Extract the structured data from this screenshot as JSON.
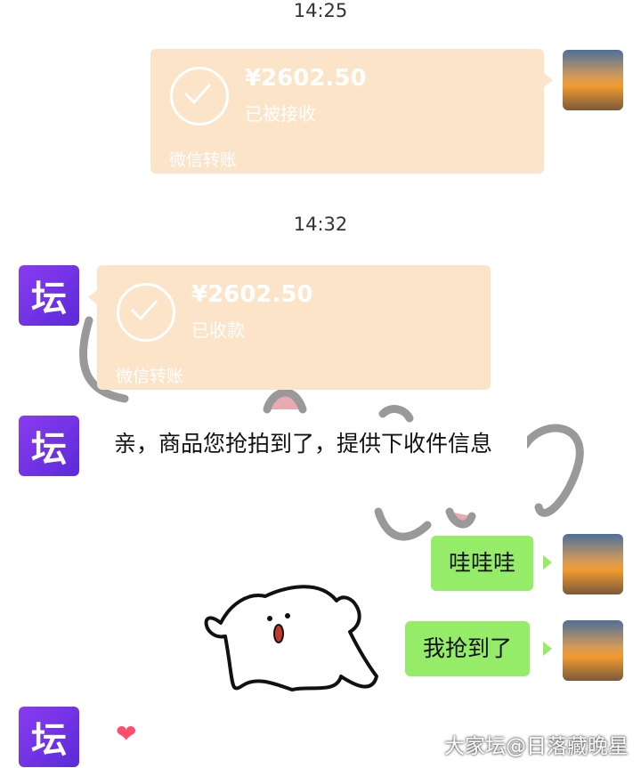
{
  "messages": {
    "time1": "14:25",
    "transfer1": {
      "amount": "¥2602.50",
      "status": "已被接收",
      "brand": "微信转账"
    },
    "time2": "14:32",
    "transfer2": {
      "amount": "¥2602.50",
      "status": "已收款",
      "brand": "微信转账"
    },
    "forum_avatar_text": "坛",
    "text_msg": "亲，商品您抢拍到了，提供下收件信息",
    "reply1": "哇哇哇",
    "reply2": "我抢到了",
    "heart": "❤"
  },
  "watermark": "大家坛@日落藏晚星",
  "colors": {
    "transfer_bg": "#fce4c9",
    "green_bubble": "#95ec69",
    "forum_avatar": "#7b35e8"
  }
}
